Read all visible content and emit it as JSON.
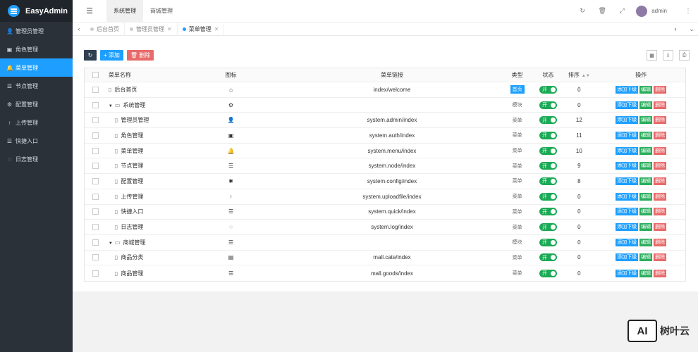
{
  "app": {
    "title": "EasyAdmin"
  },
  "sidebar": {
    "items": [
      {
        "icon": "user-icon",
        "label": "管理员管理"
      },
      {
        "icon": "id-card-icon",
        "label": "角色管理"
      },
      {
        "icon": "bell-icon",
        "label": "菜单管理",
        "active": true
      },
      {
        "icon": "list-icon",
        "label": "节点管理"
      },
      {
        "icon": "gear-icon",
        "label": "配置管理"
      },
      {
        "icon": "arrow-up-icon",
        "label": "上传管理"
      },
      {
        "icon": "list-icon",
        "label": "快捷入口"
      },
      {
        "icon": "circle-icon",
        "label": "日志管理"
      }
    ]
  },
  "topbar": {
    "tabs": [
      "系统管理",
      "商城管理"
    ],
    "user": "admin"
  },
  "pagetabs": {
    "items": [
      "后台首页",
      "管理员管理",
      "菜单管理"
    ]
  },
  "toolbar": {
    "add": "添加",
    "delete": "删除"
  },
  "table": {
    "headers": {
      "name": "菜单名称",
      "icon": "图标",
      "link": "菜单链接",
      "type": "类型",
      "status": "状态",
      "sort": "排序",
      "ops": "操作"
    },
    "ops": {
      "add_child": "添加下级",
      "edit": "编辑",
      "delete": "删除"
    },
    "status_label": "开",
    "rows": [
      {
        "name": "后台首页",
        "level": 0,
        "kind": "file",
        "icon": "home-icon",
        "link": "index/welcome",
        "type": "首页",
        "sort": "0"
      },
      {
        "name": "系统管理",
        "level": 0,
        "kind": "folder",
        "icon": "gear-icon",
        "link": "",
        "type": "模块",
        "sort": "0"
      },
      {
        "name": "管理员管理",
        "level": 1,
        "kind": "file",
        "icon": "user-icon",
        "link": "system.admin/index",
        "type": "菜单",
        "sort": "12"
      },
      {
        "name": "角色管理",
        "level": 1,
        "kind": "file",
        "icon": "id-card-icon",
        "link": "system.auth/index",
        "type": "菜单",
        "sort": "11"
      },
      {
        "name": "菜单管理",
        "level": 1,
        "kind": "file",
        "icon": "bell-icon",
        "link": "system.menu/index",
        "type": "菜单",
        "sort": "10"
      },
      {
        "name": "节点管理",
        "level": 1,
        "kind": "file",
        "icon": "list-icon",
        "link": "system.node/index",
        "type": "菜单",
        "sort": "9"
      },
      {
        "name": "配置管理",
        "level": 1,
        "kind": "file",
        "icon": "asterisk-icon",
        "link": "system.config/index",
        "type": "菜单",
        "sort": "8"
      },
      {
        "name": "上传管理",
        "level": 1,
        "kind": "file",
        "icon": "arrow-up-icon",
        "link": "system.uploadfile/index",
        "type": "菜单",
        "sort": "0"
      },
      {
        "name": "快捷入口",
        "level": 1,
        "kind": "file",
        "icon": "list-icon",
        "link": "system.quick/index",
        "type": "菜单",
        "sort": "0"
      },
      {
        "name": "日志管理",
        "level": 1,
        "kind": "file",
        "icon": "circle-icon",
        "link": "system.log/index",
        "type": "菜单",
        "sort": "0"
      },
      {
        "name": "商城管理",
        "level": 0,
        "kind": "folder",
        "icon": "list-icon",
        "link": "",
        "type": "模块",
        "sort": "0"
      },
      {
        "name": "商品分类",
        "level": 1,
        "kind": "file",
        "icon": "calendar-icon",
        "link": "mall.cate/index",
        "type": "菜单",
        "sort": "0"
      },
      {
        "name": "商品管理",
        "level": 1,
        "kind": "file",
        "icon": "list-icon",
        "link": "mall.goods/index",
        "type": "菜单",
        "sort": "0"
      }
    ]
  },
  "watermark": {
    "logo_text": "AI",
    "brand": "树叶云"
  }
}
